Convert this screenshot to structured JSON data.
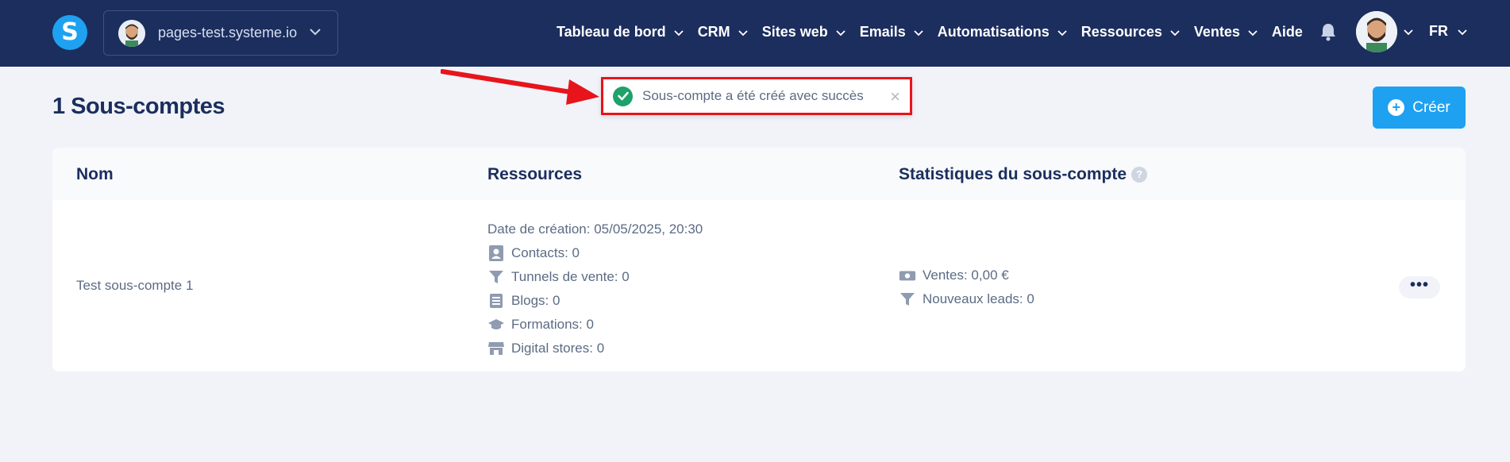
{
  "header": {
    "logo_letter": "S",
    "site_name": "pages-test.systeme.io",
    "nav": [
      {
        "label": "Tableau de bord",
        "has_dropdown": true
      },
      {
        "label": "CRM",
        "has_dropdown": true
      },
      {
        "label": "Sites web",
        "has_dropdown": true
      },
      {
        "label": "Emails",
        "has_dropdown": true
      },
      {
        "label": "Automatisations",
        "has_dropdown": true
      },
      {
        "label": "Ressources",
        "has_dropdown": true
      },
      {
        "label": "Ventes",
        "has_dropdown": true
      },
      {
        "label": "Aide",
        "has_dropdown": false
      }
    ],
    "language": "FR"
  },
  "page": {
    "title": "1 Sous-comptes",
    "create_label": "Créer"
  },
  "toast": {
    "message": "Sous-compte a été créé avec succès",
    "close": "×"
  },
  "table": {
    "columns": {
      "name": "Nom",
      "resources": "Ressources",
      "stats": "Statistiques du sous-compte",
      "help": "?"
    },
    "rows": [
      {
        "name": "Test sous-compte 1",
        "created": "Date de création: 05/05/2025, 20:30",
        "contacts": "Contacts: 0",
        "funnels": "Tunnels de vente: 0",
        "blogs": "Blogs: 0",
        "courses": "Formations: 0",
        "stores": "Digital stores: 0",
        "sales": "Ventes: 0,00 €",
        "leads": "Nouveaux leads: 0",
        "actions": "•••"
      }
    ]
  },
  "colors": {
    "topbar": "#1b2e5e",
    "accent": "#1ea1f1",
    "success": "#1fa16a",
    "highlight": "#e8141b"
  }
}
